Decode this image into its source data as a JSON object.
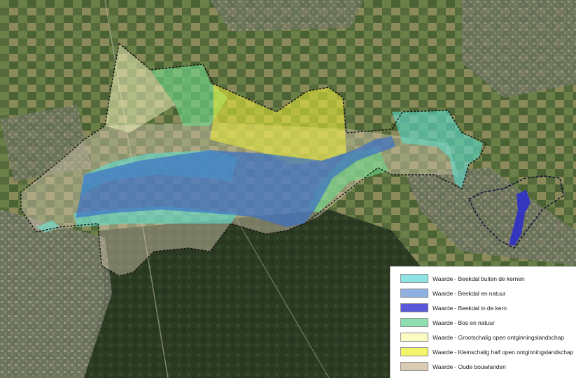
{
  "legend": {
    "items": [
      {
        "label": "Waarde - Beekdal buiten de kernen",
        "color": "#8fe3e3"
      },
      {
        "label": "Waarde - Beekdal en natuur",
        "color": "#8fb0e0"
      },
      {
        "label": "Waarde - Beekdal in de kern",
        "color": "#5858d8"
      },
      {
        "label": "Waarde - Bos en natuur",
        "color": "#8fe0b0"
      },
      {
        "label": "Waarde - Grootschalig open ontginningslandschap",
        "color": "#fbfbc4"
      },
      {
        "label": "Waarde - Kleinschalig half open ontginningslandschap",
        "color": "#f4f46a"
      },
      {
        "label": "Waarde - Oude bouwlanden",
        "color": "#d9ccb3"
      }
    ]
  }
}
